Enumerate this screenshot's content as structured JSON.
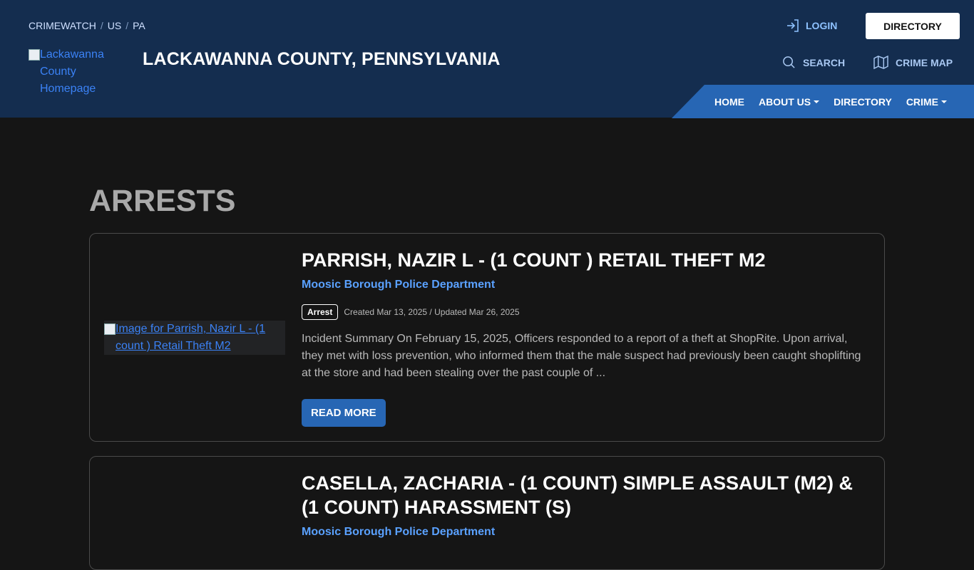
{
  "header": {
    "breadcrumb": [
      "CRIMEWATCH",
      "US",
      "PA"
    ],
    "breadcrumb_sep": "/",
    "logo_alt": "Lackawanna County Homepage",
    "site_title": "LACKAWANNA COUNTY, PENNSYLVANIA",
    "login_label": "LOGIN",
    "directory_button": "DIRECTORY",
    "search_label": "SEARCH",
    "crime_map_label": "CRIME MAP",
    "nav": {
      "home": "HOME",
      "about": "ABOUT US",
      "directory": "DIRECTORY",
      "crime": "CRIME"
    }
  },
  "main": {
    "heading": "ARRESTS",
    "cards": [
      {
        "image_alt": "Image for Parrish, Nazir L - (1 count ) Retail Theft M2",
        "title": "PARRISH, NAZIR L - (1 COUNT ) RETAIL THEFT M2",
        "department": "Moosic Borough Police Department",
        "badge": "Arrest",
        "dates": "Created Mar 13, 2025 / Updated Mar 26, 2025",
        "summary": "Incident Summary On February 15, 2025, Officers responded to a report of a theft at ShopRite. Upon arrival, they met with loss prevention, who informed them that the male suspect had previously been caught shoplifting at the store and had been stealing over the past couple of ...",
        "read_more": "READ MORE"
      },
      {
        "title": "CASELLA, ZACHARIA - (1 COUNT) SIMPLE ASSAULT (M2) & (1 COUNT) HARASSMENT (S)",
        "department": "Moosic Borough Police Department"
      }
    ]
  },
  "colors": {
    "header_bg": "#142d4f",
    "nav_bg": "#2766b4",
    "page_bg": "#151515",
    "link": "#5aa1ff"
  },
  "icons": [
    "login-icon",
    "search-icon",
    "map-icon",
    "caret-down-icon",
    "broken-image-icon"
  ]
}
